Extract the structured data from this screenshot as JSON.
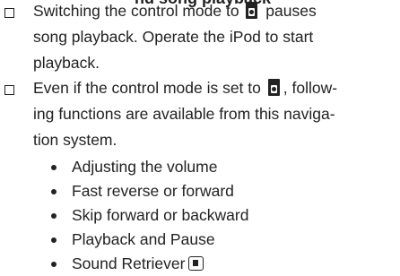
{
  "heading_fragment": "nd song playback",
  "notes": [
    {
      "lines": [
        {
          "before": "Switching the control mode to ",
          "icon": "ctrl-mode-icon",
          "after": " pauses"
        },
        {
          "text": "song playback. Operate the iPod to start"
        },
        {
          "text": "playback."
        }
      ]
    },
    {
      "lines": [
        {
          "before": "Even if the control mode is set to ",
          "icon": "ctrl-mode-icon",
          "after": ", follow-"
        },
        {
          "text": "ing functions are available from this naviga-"
        },
        {
          "text": "tion system."
        }
      ]
    }
  ],
  "functions": [
    {
      "text": "Adjusting the volume"
    },
    {
      "text": "Fast reverse or forward"
    },
    {
      "text": "Skip forward or backward"
    },
    {
      "text": "Playback and Pause"
    },
    {
      "text": "Sound Retriever",
      "icon": "sound-retriever-icon"
    }
  ]
}
